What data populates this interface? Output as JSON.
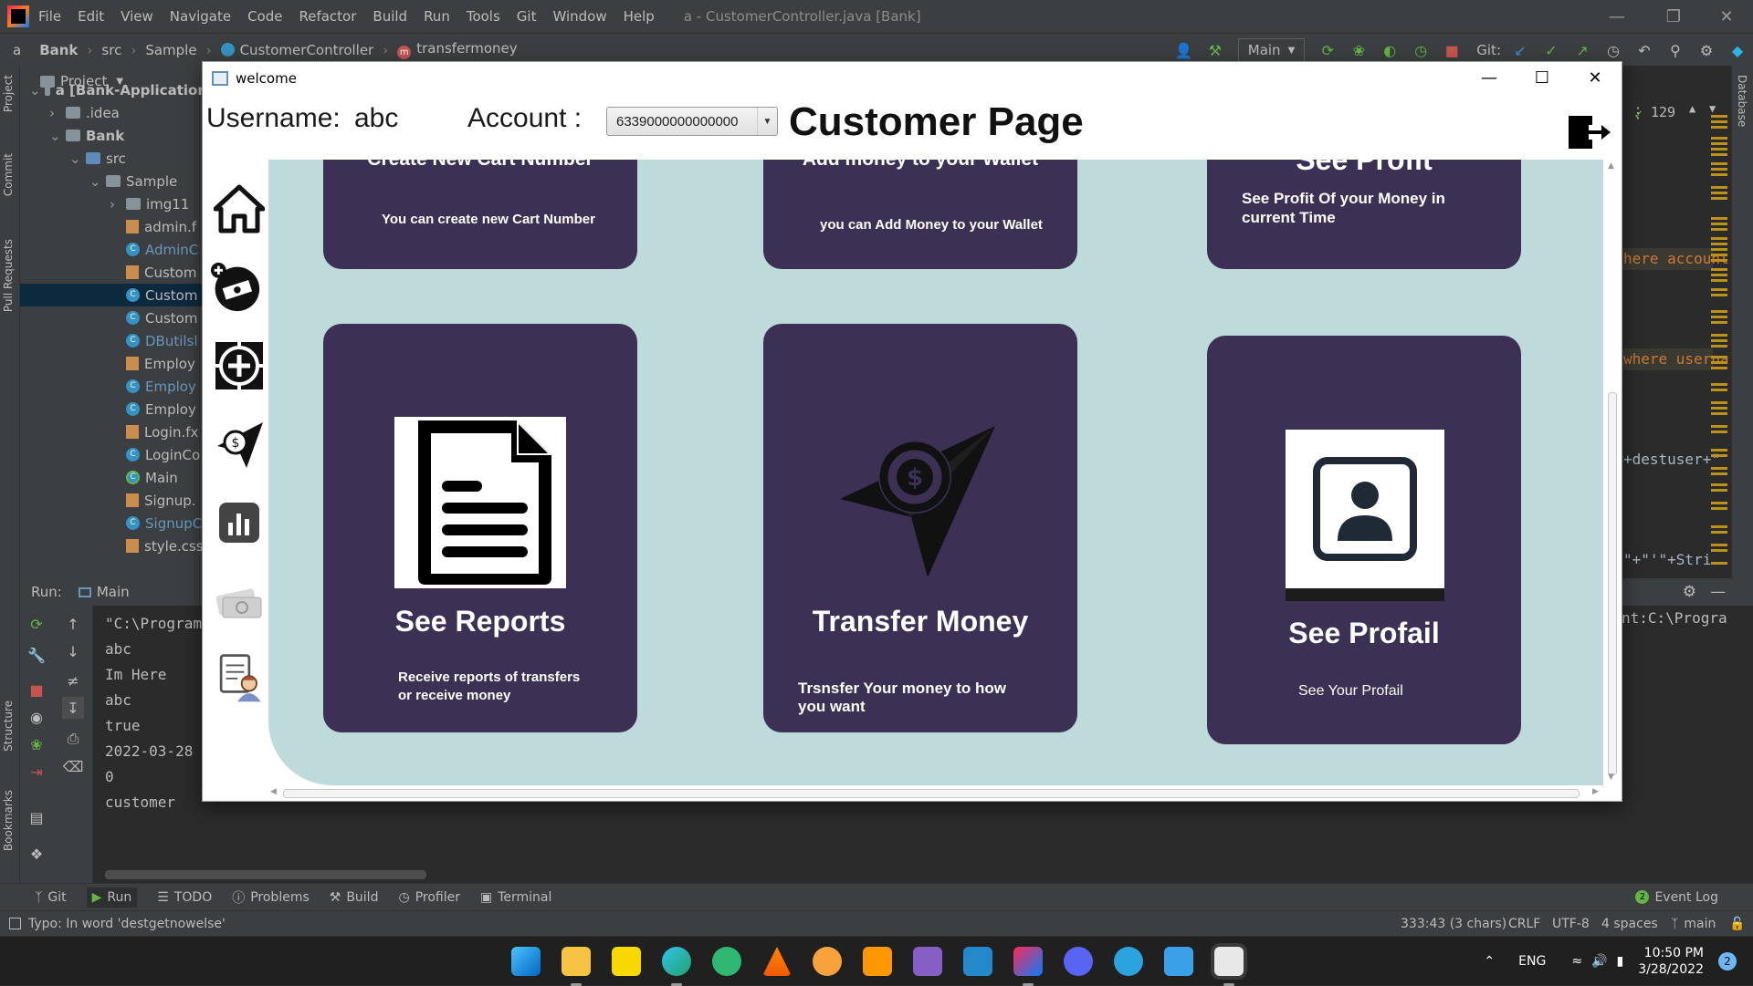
{
  "ide": {
    "menu": [
      "File",
      "Edit",
      "View",
      "Navigate",
      "Code",
      "Refactor",
      "Build",
      "Run",
      "Tools",
      "Git",
      "Window",
      "Help"
    ],
    "window_title": "a - CustomerController.java [Bank]",
    "breadcrumbs": [
      "a",
      "Bank",
      "src",
      "Sample",
      "CustomerController",
      "transfermoney"
    ],
    "run_config": "Main",
    "git_label": "Git:",
    "project_label": "Project",
    "left_tools": [
      "Project",
      "Commit",
      "Pull Requests",
      "Structure",
      "Bookmarks"
    ],
    "right_tools": [
      "Database"
    ],
    "tree": [
      {
        "label": "a [Bank-Application",
        "kind": "folder",
        "indent": 0,
        "bold": true
      },
      {
        "label": ".idea",
        "kind": "folder",
        "indent": 1
      },
      {
        "label": "Bank",
        "kind": "folder",
        "indent": 1,
        "bold": true
      },
      {
        "label": "src",
        "kind": "folder-blue",
        "indent": 2
      },
      {
        "label": "Sample",
        "kind": "folder",
        "indent": 3
      },
      {
        "label": "img11",
        "kind": "folder",
        "indent": 4
      },
      {
        "label": "admin.f",
        "kind": "fx",
        "indent": 4
      },
      {
        "label": "AdminC",
        "kind": "cls-blue",
        "indent": 4
      },
      {
        "label": "Custom",
        "kind": "fx",
        "indent": 4
      },
      {
        "label": "Custom",
        "kind": "cls",
        "indent": 4,
        "selected": true
      },
      {
        "label": "Custom",
        "kind": "cls",
        "indent": 4
      },
      {
        "label": "DButilsl",
        "kind": "cls-blue",
        "indent": 4
      },
      {
        "label": "Employ",
        "kind": "fx",
        "indent": 4
      },
      {
        "label": "Employ",
        "kind": "cls-blue",
        "indent": 4
      },
      {
        "label": "Employ",
        "kind": "cls",
        "indent": 4
      },
      {
        "label": "Login.fx",
        "kind": "fx",
        "indent": 4
      },
      {
        "label": "LoginCo",
        "kind": "cls",
        "indent": 4
      },
      {
        "label": "Main",
        "kind": "main",
        "indent": 4
      },
      {
        "label": "Signup.",
        "kind": "fx",
        "indent": 4
      },
      {
        "label": "SignupC",
        "kind": "cls-blue",
        "indent": 4
      },
      {
        "label": "style.css",
        "kind": "css",
        "indent": 4
      }
    ],
    "editor": {
      "line_count": "129",
      "snippets": [
        "here account",
        "where userna",
        "+destuser+\"",
        "\"+\"'\"+Stri"
      ]
    },
    "run": {
      "label": "Run:",
      "tab": "Main",
      "console": [
        "\"C:\\Program",
        "abc",
        "Im Here",
        "abc",
        "true",
        "2022-03-28",
        "0",
        "customer"
      ],
      "right_text": "nt:C:\\Progra"
    },
    "bottom_tools": [
      "Git",
      "Run",
      "TODO",
      "Problems",
      "Build",
      "Profiler",
      "Terminal"
    ],
    "event_log": "Event Log",
    "event_count": "2",
    "status": {
      "message": "Typo: In word 'destgetnowelse'",
      "position": "333:43 (3 chars)",
      "line_sep": "CRLF",
      "encoding": "UTF-8",
      "indent": "4 spaces",
      "branch": "main"
    }
  },
  "app": {
    "window_title": "welcome",
    "username_label": "Username:",
    "username_value": "abc",
    "account_label": "Account :",
    "account_value": "6339000000000000",
    "page_title": "Customer Page",
    "sidebar_icons": [
      "home-icon",
      "add-money-icon",
      "add-card-icon",
      "transfer-icon",
      "chart-icon",
      "cash-icon",
      "profile-report-icon"
    ],
    "cards_top": [
      {
        "title": "Create New Cart Number",
        "desc": "You can create new Cart Number"
      },
      {
        "title": "Add money to your Wallet",
        "desc": "you can Add Money to your Wallet"
      },
      {
        "title": "See Profit",
        "desc": "See Profit Of your Money in current Time"
      }
    ],
    "cards": [
      {
        "title": "See Reports",
        "desc": "Receive reports of transfers or receive money",
        "icon": "document-icon"
      },
      {
        "title": "Transfer Money",
        "desc": "Trsnsfer Your money to how you want",
        "icon": "money-plane-icon"
      },
      {
        "title": "See Profail",
        "desc": "See Your Profail",
        "icon": "user-profile-icon"
      }
    ]
  },
  "taskbar": {
    "lang": "ENG",
    "time": "10:50 PM",
    "date": "3/28/2022",
    "notifications": "2"
  },
  "colors": {
    "card": "#3c3154",
    "content_bg": "#bfdadb",
    "ide_bg": "#2b2b2b",
    "ide_panel": "#3c3f41"
  }
}
